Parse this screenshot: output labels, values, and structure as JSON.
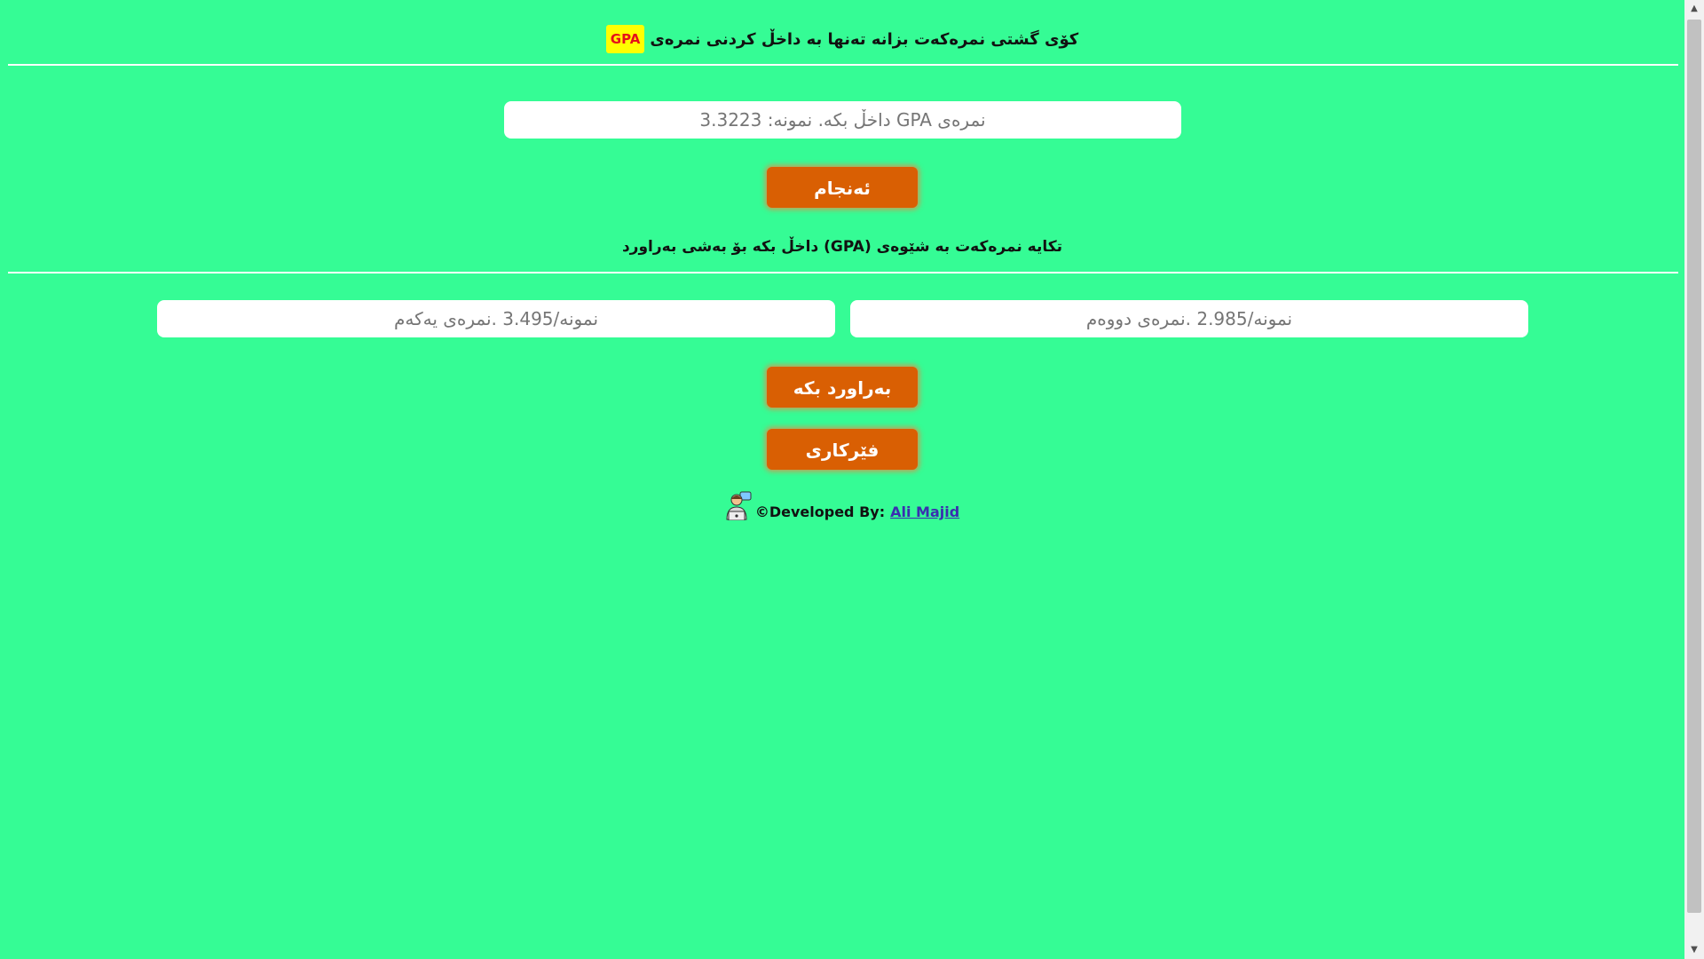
{
  "header": {
    "title_text": "کۆی گشتی نمرەکەت بزانە تەنها بە داخڵ کردنی نمرەی",
    "badge": "GPA"
  },
  "gpa_input": {
    "placeholder": "نمرەی GPA داخڵ بکە. نمونە: 3.3223"
  },
  "buttons": {
    "done": "ئەنجام",
    "compare": "بەراورد بکە",
    "learn": "فێرکاری"
  },
  "instruction": "تکایە نمرەکەت بە شێوەی (GPA) داخڵ بکە بۆ بەشی بەراورد",
  "compare_inputs": {
    "first_placeholder": "نمونە/3.495 .نمرەی یەکەم",
    "second_placeholder": "نمونە/2.985 .نمرەی دووەم"
  },
  "footer": {
    "credit": "©Developed By:",
    "author": "Ali Majid"
  },
  "colors": {
    "background": "#35fc95",
    "button": "#d95f03",
    "badge_bg": "#ffff00",
    "badge_text": "#e5101a"
  }
}
